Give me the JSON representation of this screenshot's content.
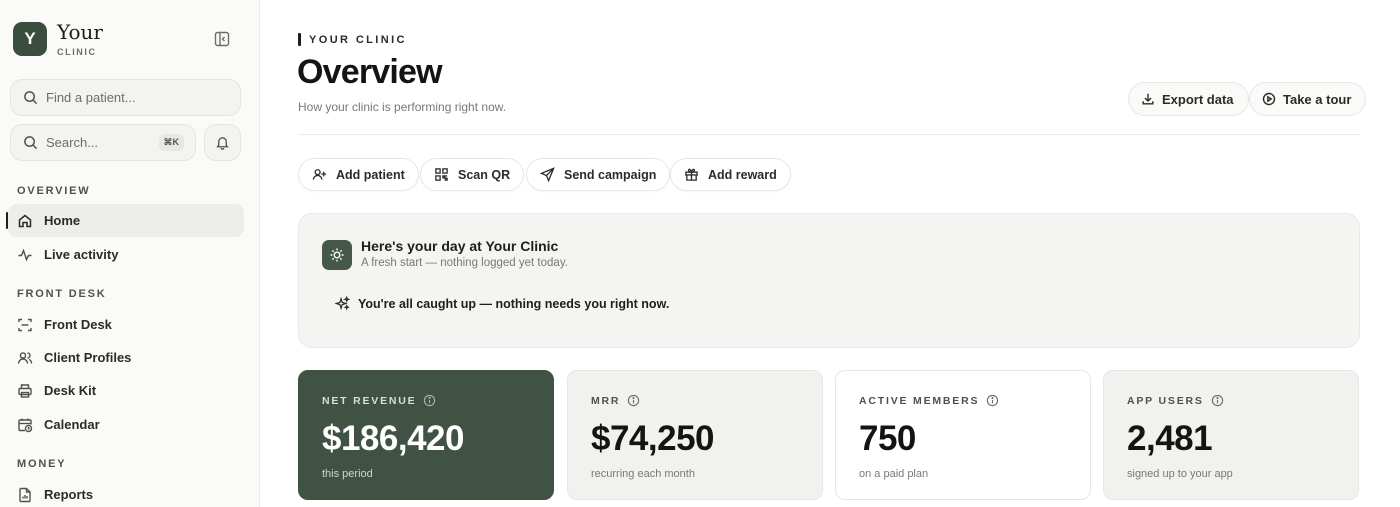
{
  "brand": {
    "logo_letter": "Y",
    "name": "Your",
    "sub": "CLINIC"
  },
  "sidebar": {
    "find_placeholder": "Find a patient...",
    "search_placeholder": "Search...",
    "search_shortcut": "⌘K",
    "sections": {
      "overview": "OVERVIEW",
      "front_desk": "FRONT DESK",
      "money": "MONEY"
    },
    "items": {
      "home": "Home",
      "live_activity": "Live activity",
      "front_desk": "Front Desk",
      "client_profiles": "Client Profiles",
      "desk_kit": "Desk Kit",
      "calendar": "Calendar",
      "reports": "Reports"
    },
    "active_item": "home"
  },
  "header": {
    "eyebrow": "YOUR CLINIC",
    "title": "Overview",
    "subtitle": "How your clinic is performing right now.",
    "export_label": "Export data",
    "tour_label": "Take a tour"
  },
  "actions": {
    "add_patient": "Add patient",
    "scan_qr": "Scan QR",
    "send_campaign": "Send campaign",
    "add_reward": "Add reward"
  },
  "day_card": {
    "title": "Here's your day at Your Clinic",
    "subtitle": "A fresh start — nothing logged yet today.",
    "status": "You're all caught up — nothing needs you right now."
  },
  "stats": [
    {
      "label": "NET REVENUE",
      "value": "$186,420",
      "note": "this period"
    },
    {
      "label": "MRR",
      "value": "$74,250",
      "note": "recurring each month"
    },
    {
      "label": "ACTIVE MEMBERS",
      "value": "750",
      "note": "on a paid plan"
    },
    {
      "label": "APP USERS",
      "value": "2,481",
      "note": "signed up to your app"
    }
  ],
  "colors": {
    "accent": "#3f5243",
    "background": "#ffffff",
    "sidebar": "#fafaf9"
  }
}
